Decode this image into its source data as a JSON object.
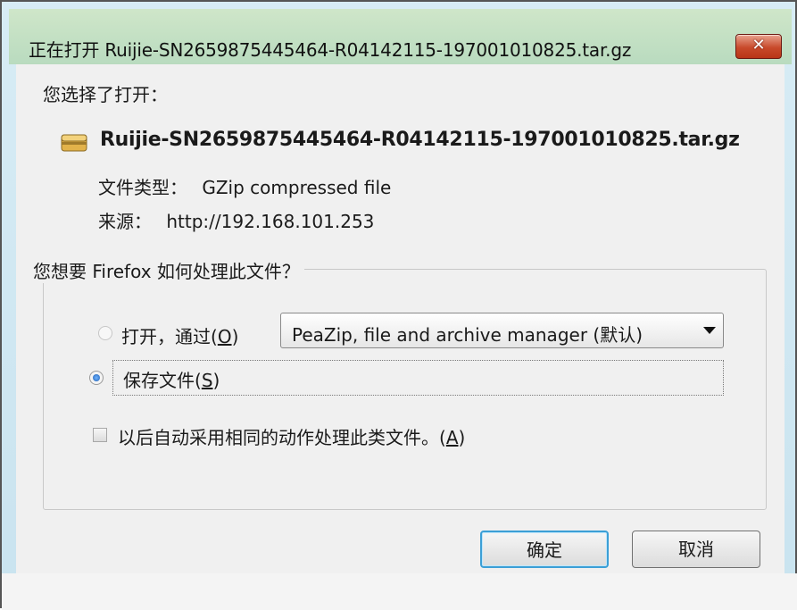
{
  "window": {
    "title": "正在打开 Ruijie-SN2659875445464-R04142115-197001010825.tar.gz",
    "close_glyph": "✕"
  },
  "dialog": {
    "intro": "您选择了打开：",
    "file_name": "Ruijie-SN2659875445464-R04142115-197001010825.tar.gz",
    "file_type_label": "文件类型：",
    "file_type_value": "GZip compressed file",
    "source_label": "来源：",
    "source_value": "http://192.168.101.253",
    "action_group": {
      "legend": "您想要 Firefox 如何处理此文件？",
      "open_with_label": "打开，通过",
      "open_with_accel": "O",
      "open_with_app": "PeaZip, file and archive manager (默认)",
      "save_label": "保存文件",
      "save_accel": "S",
      "remember_label": "以后自动采用相同的动作处理此类文件。",
      "remember_accel": "A"
    },
    "buttons": {
      "ok": "确定",
      "cancel": "取消"
    }
  },
  "state": {
    "selected_action": "save",
    "remember_checked": false
  },
  "colors": {
    "title_bar": "#b9dbbf",
    "close_button": "#c84a2b",
    "focus_border": "#3c9fd6",
    "dialog_bg": "#f0f0f0"
  },
  "icons": {
    "file": "archive-file-icon",
    "close": "close-icon",
    "dropdown": "chevron-down-icon"
  }
}
